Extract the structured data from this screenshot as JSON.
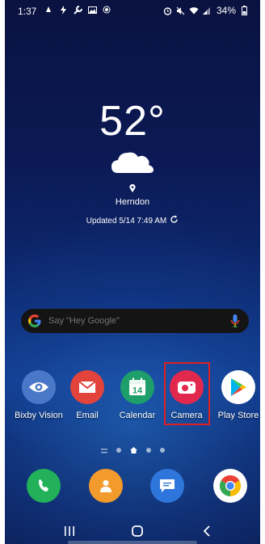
{
  "status_bar": {
    "time": "1:37",
    "battery": "34%",
    "left_icons": [
      "notification-icon",
      "flash-icon",
      "wrench-icon",
      "gallery-icon",
      "record-icon"
    ],
    "right_icons": [
      "alarm-icon",
      "mute-icon",
      "wifi-icon",
      "signal-icon"
    ]
  },
  "weather": {
    "temperature": "52°",
    "condition_icon": "cloud-icon",
    "location": "Herndon",
    "updated": "Updated 5/14 7:49 AM"
  },
  "search": {
    "placeholder": "Say \"Hey Google\""
  },
  "apps": [
    {
      "label": "Bixby Vision",
      "icon": "eye-icon",
      "color": "#4a78c8"
    },
    {
      "label": "Email",
      "icon": "envelope-icon",
      "color": "#e2433b"
    },
    {
      "label": "Calendar",
      "icon": "calendar-icon",
      "color": "#1e9e6a",
      "day": "14"
    },
    {
      "label": "Camera",
      "icon": "camera-icon",
      "color": "#e2284c"
    },
    {
      "label": "Play Store",
      "icon": "play-store-icon",
      "color": "#ffffff"
    }
  ],
  "page_indicators": {
    "count": 5,
    "current_index": 2
  },
  "dock": [
    {
      "name": "Phone",
      "icon": "phone-icon",
      "color": "#22b05b"
    },
    {
      "name": "Contacts",
      "icon": "contacts-icon",
      "color": "#f39a2c"
    },
    {
      "name": "Messages",
      "icon": "messages-icon",
      "color": "#2f76dc"
    },
    {
      "name": "Chrome",
      "icon": "chrome-icon",
      "color": "#ffffff"
    }
  ],
  "navigation": {
    "icons": [
      "recents-icon",
      "home-icon",
      "back-icon"
    ]
  },
  "colors": {
    "highlight": "#e02020"
  }
}
